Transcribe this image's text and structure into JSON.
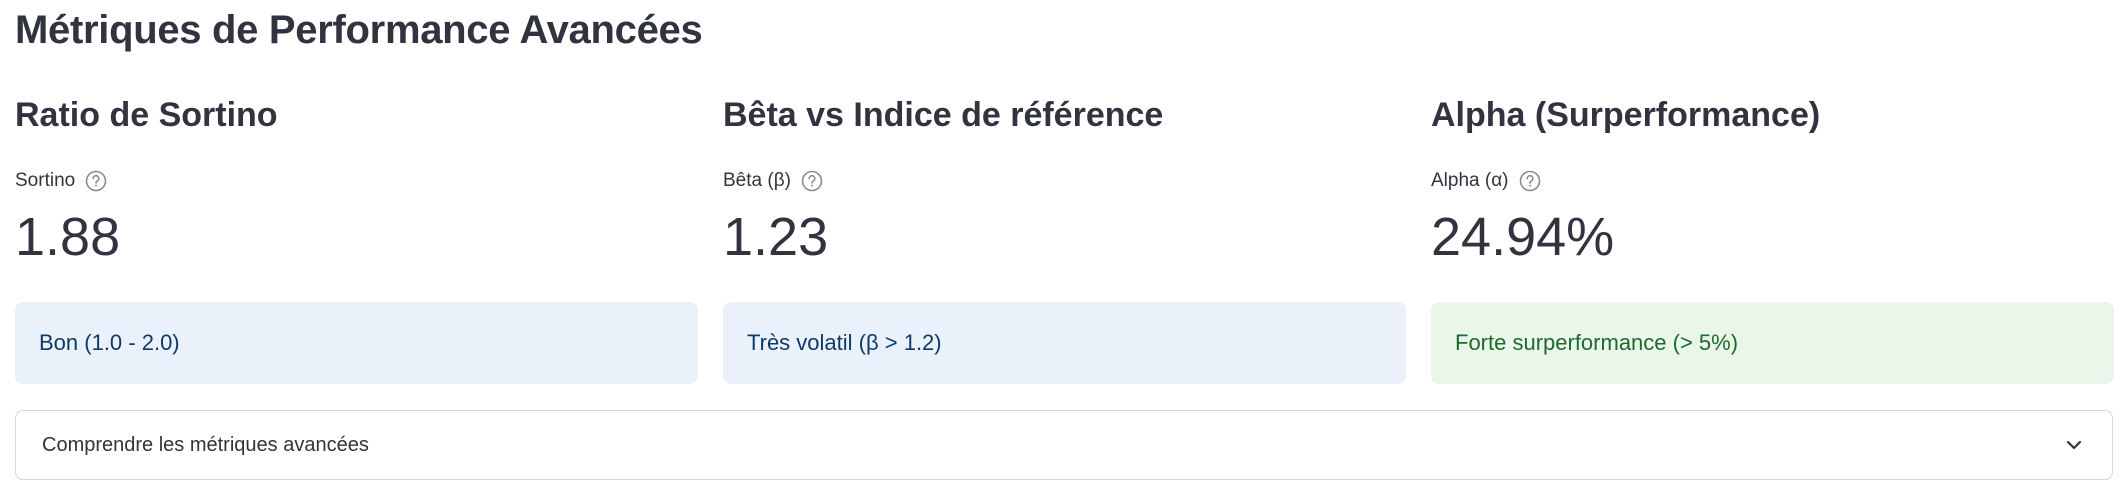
{
  "page": {
    "title": "Métriques de Performance Avancées"
  },
  "metrics": [
    {
      "title": "Ratio de Sortino",
      "label": "Sortino",
      "value": "1.88",
      "alert": "Bon (1.0 - 2.0)",
      "alert_type": "info",
      "help_icon": "question-circle-icon"
    },
    {
      "title": "Bêta vs Indice de référence",
      "label": "Bêta (β)",
      "value": "1.23",
      "alert": "Très volatil (β > 1.2)",
      "alert_type": "info",
      "help_icon": "question-circle-icon"
    },
    {
      "title": "Alpha (Surperformance)",
      "label": "Alpha (α)",
      "value": "24.94%",
      "alert": "Forte surperformance (> 5%)",
      "alert_type": "success",
      "help_icon": "question-circle-icon"
    }
  ],
  "expander": {
    "label": "Comprendre les métriques avancées",
    "icon": "chevron-down-icon"
  },
  "colors": {
    "text": "#31333f",
    "info_bg": "#eaf1fb",
    "info_text": "#0e3a6b",
    "success_bg": "#eaf6ea",
    "success_text": "#1b6b2a"
  }
}
